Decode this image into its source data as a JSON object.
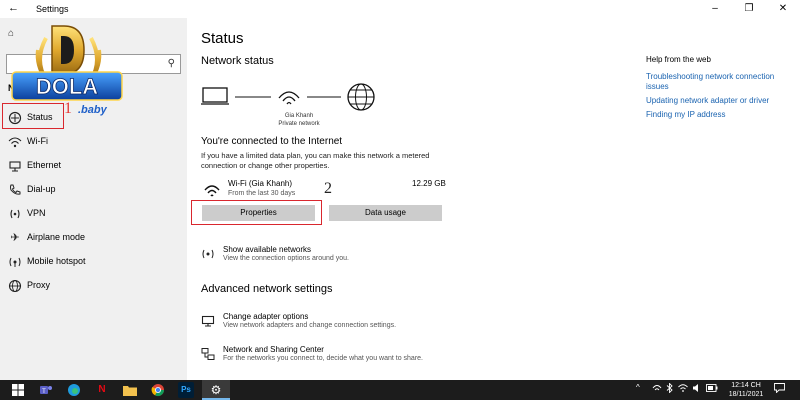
{
  "window": {
    "title": "Settings",
    "back_glyph": "←",
    "minimize_glyph": "–",
    "maximize_glyph": "❐",
    "close_glyph": "✕"
  },
  "logo": {
    "letter": "D",
    "word": "DOLA",
    "suffix": ".baby"
  },
  "sidebar": {
    "home_glyph": "⌂",
    "search_placeholder": "",
    "section_label": "Net",
    "items": [
      {
        "label": "Status",
        "icon": "globe-network-icon"
      },
      {
        "label": "Wi-Fi",
        "icon": "wifi-icon"
      },
      {
        "label": "Ethernet",
        "icon": "ethernet-icon"
      },
      {
        "label": "Dial-up",
        "icon": "phone-icon"
      },
      {
        "label": "VPN",
        "icon": "vpn-icon"
      },
      {
        "label": "Airplane mode",
        "icon": "airplane-icon"
      },
      {
        "label": "Mobile hotspot",
        "icon": "hotspot-icon"
      },
      {
        "label": "Proxy",
        "icon": "globe-icon"
      }
    ],
    "marker": "1"
  },
  "main": {
    "title": "Status",
    "network_status_heading": "Network status",
    "network_name": "Gia Khanh",
    "network_type": "Private network",
    "connected_heading": "You're connected to the Internet",
    "connected_text": "If you have a limited data plan, you can make this network a metered connection or change other properties.",
    "connection": {
      "name": "Wi-Fi (Gia Khanh)",
      "period": "From the last 30 days",
      "usage": "12.29 GB"
    },
    "properties_button": "Properties",
    "data_usage_button": "Data usage",
    "marker": "2",
    "show_networks": {
      "title": "Show available networks",
      "desc": "View the connection options around you."
    },
    "advanced_heading": "Advanced network settings",
    "adapter_options": {
      "title": "Change adapter options",
      "desc": "View network adapters and change connection settings."
    },
    "sharing_center": {
      "title": "Network and Sharing Center",
      "desc": "For the networks you connect to, decide what you want to share."
    }
  },
  "help": {
    "title": "Help from the web",
    "links": [
      "Troubleshooting network connection issues",
      "Updating network adapter or driver",
      "Finding my IP address"
    ]
  },
  "taskbar": {
    "time": "12:14 CH",
    "date": "18/11/2021",
    "ps_label": "Ps",
    "netflix_label": "N",
    "tray_chevron": "^"
  },
  "colors": {
    "highlight": "#d9272e",
    "link": "#1a63b0",
    "taskbar": "#1c1c1c"
  }
}
